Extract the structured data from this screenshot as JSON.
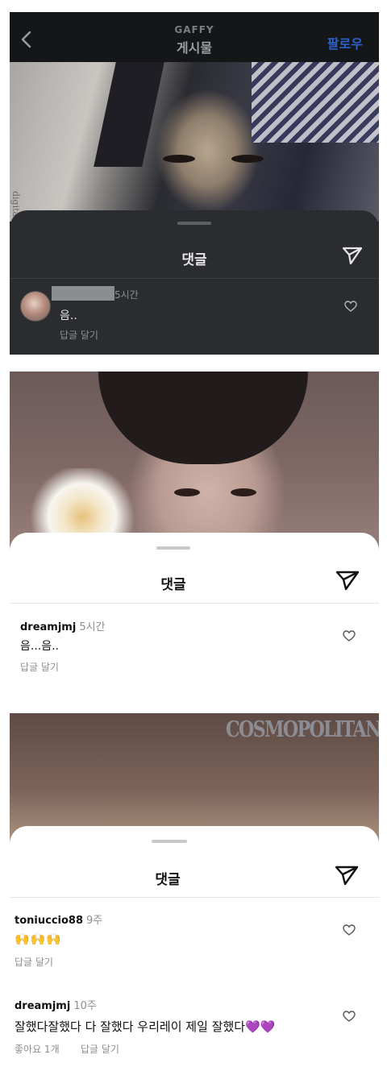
{
  "panel1": {
    "header": {
      "subtitle": "GAFFY",
      "title": "게시물",
      "follow_label": "팔로우",
      "back_icon": "chevron-left-icon"
    },
    "photo_watermark": "digital.ritual",
    "sheet": {
      "title": "댓글",
      "send_icon": "send-icon",
      "comment": {
        "time": "5시간",
        "text": "음..",
        "reply_label": "답글 달기",
        "like_icon": "heart-icon"
      }
    }
  },
  "panel2": {
    "sheet": {
      "title": "댓글",
      "send_icon": "send-icon",
      "comment": {
        "username": "dreamjmj",
        "time": "5시간",
        "text": "음...음..",
        "reply_label": "답글 달기",
        "like_icon": "heart-icon"
      }
    }
  },
  "panel3": {
    "photo_brand": "COSMOPOLITAN",
    "sheet": {
      "title": "댓글",
      "send_icon": "send-icon",
      "comments": [
        {
          "username": "toniuccio88",
          "time": "9주",
          "text": "🙌🙌🙌",
          "reply_label": "답글 달기",
          "like_icon": "heart-icon"
        },
        {
          "username": "dreamjmj",
          "time": "10주",
          "text": "잘했다잘했다 다 잘했다 우리레이 제일 잘했다💜💜",
          "likes_label": "좋아요 1개",
          "reply_label": "답글 달기",
          "like_icon": "heart-icon"
        }
      ]
    }
  },
  "colors": {
    "follow_blue": "#2b61c9",
    "dark_sheet": "#2b2c2f",
    "muted_text": "#8e8e8e"
  }
}
